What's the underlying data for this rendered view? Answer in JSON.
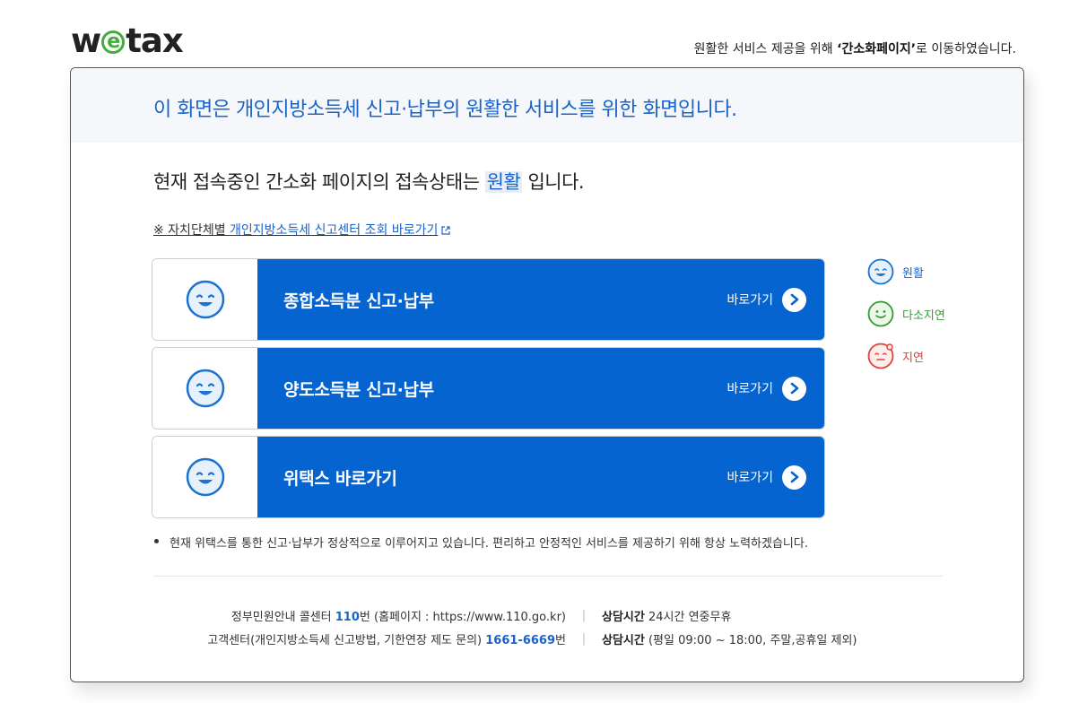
{
  "header": {
    "logo_pre": "w",
    "logo_e": "e",
    "logo_post": "tax",
    "notice_prefix": "원활한 서비스 제공을 위해 ",
    "notice_emph": "‘간소화페이지’",
    "notice_suffix": "로 이동하였습니다."
  },
  "panel": {
    "headline": "이 화면은 개인지방소득세 신고·납부의 원활한 서비스를 위한 화면입니다.",
    "status_prefix": "현재 접속중인 간소화 페이지의 접속상태는 ",
    "status_value": "원활",
    "status_suffix": " 입니다.",
    "center_link_prefix": "※ 자치단체별 ",
    "center_link_text": "개인지방소득세 신고센터 조회 바로가기"
  },
  "cards": [
    {
      "title": "종합소득분 신고·납부",
      "go": "바로가기"
    },
    {
      "title": "양도소득분 신고·납부",
      "go": "바로가기"
    },
    {
      "title": "위택스 바로가기",
      "go": "바로가기"
    }
  ],
  "legend": [
    {
      "label": "원활",
      "color": "#1a63c9"
    },
    {
      "label": "다소지연",
      "color": "#2f9e2f"
    },
    {
      "label": "지연",
      "color": "#e0413a"
    }
  ],
  "note": "현재 위택스를 통한 신고·납부가 정상적으로 이루어지고 있습니다. 편리하고 안정적인 서비스를 제공하기 위해 항상 노력하겠습니다.",
  "footer": {
    "row1_left_prefix": "정부민원안내 콜센터 ",
    "row1_left_num": "110",
    "row1_left_suffix": "번 (홈페이지 : https://www.110.go.kr)",
    "row1_right_label": "상담시간",
    "row1_right_value": " 24시간 연중무휴",
    "row2_left_prefix": "고객센터(개인지방소득세 신고방법, 기한연장 제도 문의) ",
    "row2_left_num": "1661-6669",
    "row2_left_suffix": "번",
    "row2_right_label": "상담시간",
    "row2_right_value": " (평일 09:00 ~ 18:00, 주말,공휴일 제외)",
    "separator": "|"
  },
  "colors": {
    "brand_blue": "#0664d0",
    "text_blue": "#1a63c9",
    "logo_green": "#3fae3b"
  }
}
